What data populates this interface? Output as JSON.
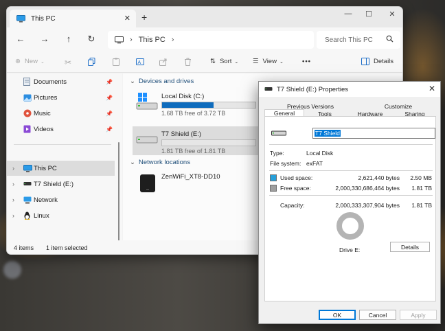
{
  "colors": {
    "accent": "#0f6cbd",
    "used": "#26a0da",
    "free": "#9e9e9e",
    "selection": "#0078d7"
  },
  "explorer": {
    "tab_title": "This PC",
    "address": {
      "location": "This PC"
    },
    "search": {
      "placeholder": "Search This PC"
    },
    "commands": {
      "new": "New",
      "sort": "Sort",
      "view": "View",
      "more": "•••",
      "details": "Details"
    },
    "sidebar": {
      "quick_access": [
        {
          "label": "Documents",
          "icon": "documents-icon"
        },
        {
          "label": "Pictures",
          "icon": "pictures-icon"
        },
        {
          "label": "Music",
          "icon": "music-icon"
        },
        {
          "label": "Videos",
          "icon": "videos-icon"
        }
      ],
      "tree": [
        {
          "label": "This PC",
          "icon": "computer-icon",
          "selected": true
        },
        {
          "label": "T7 Shield (E:)",
          "icon": "drive-icon"
        },
        {
          "label": "Network",
          "icon": "network-icon"
        },
        {
          "label": "Linux",
          "icon": "linux-icon"
        }
      ]
    },
    "groups": {
      "devices": "Devices and drives",
      "network": "Network locations"
    },
    "drives": [
      {
        "name": "Local Disk (C:)",
        "free_text": "1.68 TB free of 3.72 TB",
        "used_fraction": 0.55,
        "icon": "windows-drive-icon"
      },
      {
        "name": "T7 Shield (E:)",
        "free_text": "1.81 TB free of 1.81 TB",
        "used_fraction": 0.0,
        "icon": "drive-icon",
        "selected": true
      }
    ],
    "network_locations": [
      {
        "name": "ZenWiFi_XT8-DD10",
        "icon": "router-icon"
      }
    ],
    "status": {
      "items": "4 items",
      "selected": "1 item selected"
    }
  },
  "properties": {
    "title": "T7 Shield (E:) Properties",
    "tabs_row1": [
      "Previous Versions",
      "Customize"
    ],
    "tabs_row2": [
      "General",
      "Tools",
      "Hardware",
      "Sharing"
    ],
    "selected_tab": "General",
    "volume_label": "T7 Shield",
    "type_label": "Type:",
    "type_value": "Local Disk",
    "fs_label": "File system:",
    "fs_value": "exFAT",
    "used_label": "Used space:",
    "used_bytes": "2,621,440 bytes",
    "used_size": "2.50 MB",
    "free_label": "Free space:",
    "free_bytes": "2,000,330,686,464 bytes",
    "free_size": "1.81 TB",
    "capacity_label": "Capacity:",
    "capacity_bytes": "2,000,333,307,904 bytes",
    "capacity_size": "1.81 TB",
    "used_fraction": 1.3e-06,
    "drive_label": "Drive E:",
    "details_button": "Details",
    "ok": "OK",
    "cancel": "Cancel",
    "apply": "Apply"
  }
}
